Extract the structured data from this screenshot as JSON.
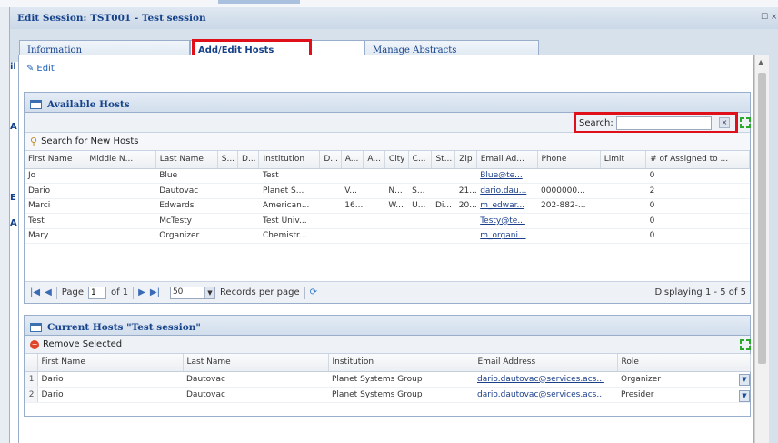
{
  "window": {
    "title": "Edit Session: TST001 - Test session",
    "controls": "☐ ×"
  },
  "gutter_letters": [
    "il",
    "A",
    "E",
    "A"
  ],
  "tabs": [
    {
      "label": "Information"
    },
    {
      "label": "Add/Edit Hosts"
    },
    {
      "label": "Manage Abstracts"
    }
  ],
  "edit_label": "Edit",
  "available": {
    "title": "Available Hosts",
    "search_label": "Search:",
    "search_value": "",
    "search_new_label": "Search for New Hosts",
    "columns": [
      "First Name",
      "Middle N...",
      "Last Name",
      "S...",
      "D...",
      "Institution",
      "D...",
      "A...",
      "A...",
      "City",
      "C...",
      "St...",
      "Zip",
      "Email Ad...",
      "Phone",
      "Limit",
      "# of Assigned to ..."
    ],
    "rows": [
      [
        "Jo",
        "",
        "Blue",
        "",
        "",
        "Test",
        "",
        "",
        "",
        "",
        "",
        "",
        "",
        "Blue@te...",
        "",
        "",
        "0"
      ],
      [
        "Dario",
        "",
        "Dautovac",
        "",
        "",
        "Planet S...",
        "",
        "V...",
        "",
        "N...",
        "S...",
        "",
        "21...",
        "dario.dau...",
        "0000000...",
        "",
        "2"
      ],
      [
        "Marci",
        "",
        "Edwards",
        "",
        "",
        "American...",
        "",
        "16...",
        "",
        "W...",
        "U...",
        "Di...",
        "20...",
        "m_edwar...",
        "202-882-...",
        "",
        "0"
      ],
      [
        "Test",
        "",
        "McTesty",
        "",
        "",
        "Test Univ...",
        "",
        "",
        "",
        "",
        "",
        "",
        "",
        "Testy@te...",
        "",
        "",
        "0"
      ],
      [
        "Mary",
        "",
        "Organizer",
        "",
        "",
        "Chemistr...",
        "",
        "",
        "",
        "",
        "",
        "",
        "",
        "m_organi...",
        "",
        "",
        "0"
      ]
    ],
    "paging": {
      "page_label": "Page",
      "page_value": "1",
      "of_label": "of 1",
      "page_size": "50",
      "records_label": "Records per page",
      "displaying": "Displaying 1 - 5 of 5"
    }
  },
  "current": {
    "title": "Current Hosts \"Test session\"",
    "remove_label": "Remove Selected",
    "columns": [
      "",
      "First Name",
      "Last Name",
      "Institution",
      "Email Address",
      "Role"
    ],
    "rows": [
      [
        "1",
        "Dario",
        "Dautovac",
        "Planet Systems Group",
        "dario.dautovac@services.acs...",
        "Organizer"
      ],
      [
        "2",
        "Dario",
        "Dautovac",
        "Planet Systems Group",
        "dario.dautovac@services.acs...",
        "Presider"
      ]
    ]
  },
  "colors": {
    "highlight": "#e0101a",
    "header_text": "#15428b",
    "link": "#1b5fb5"
  }
}
